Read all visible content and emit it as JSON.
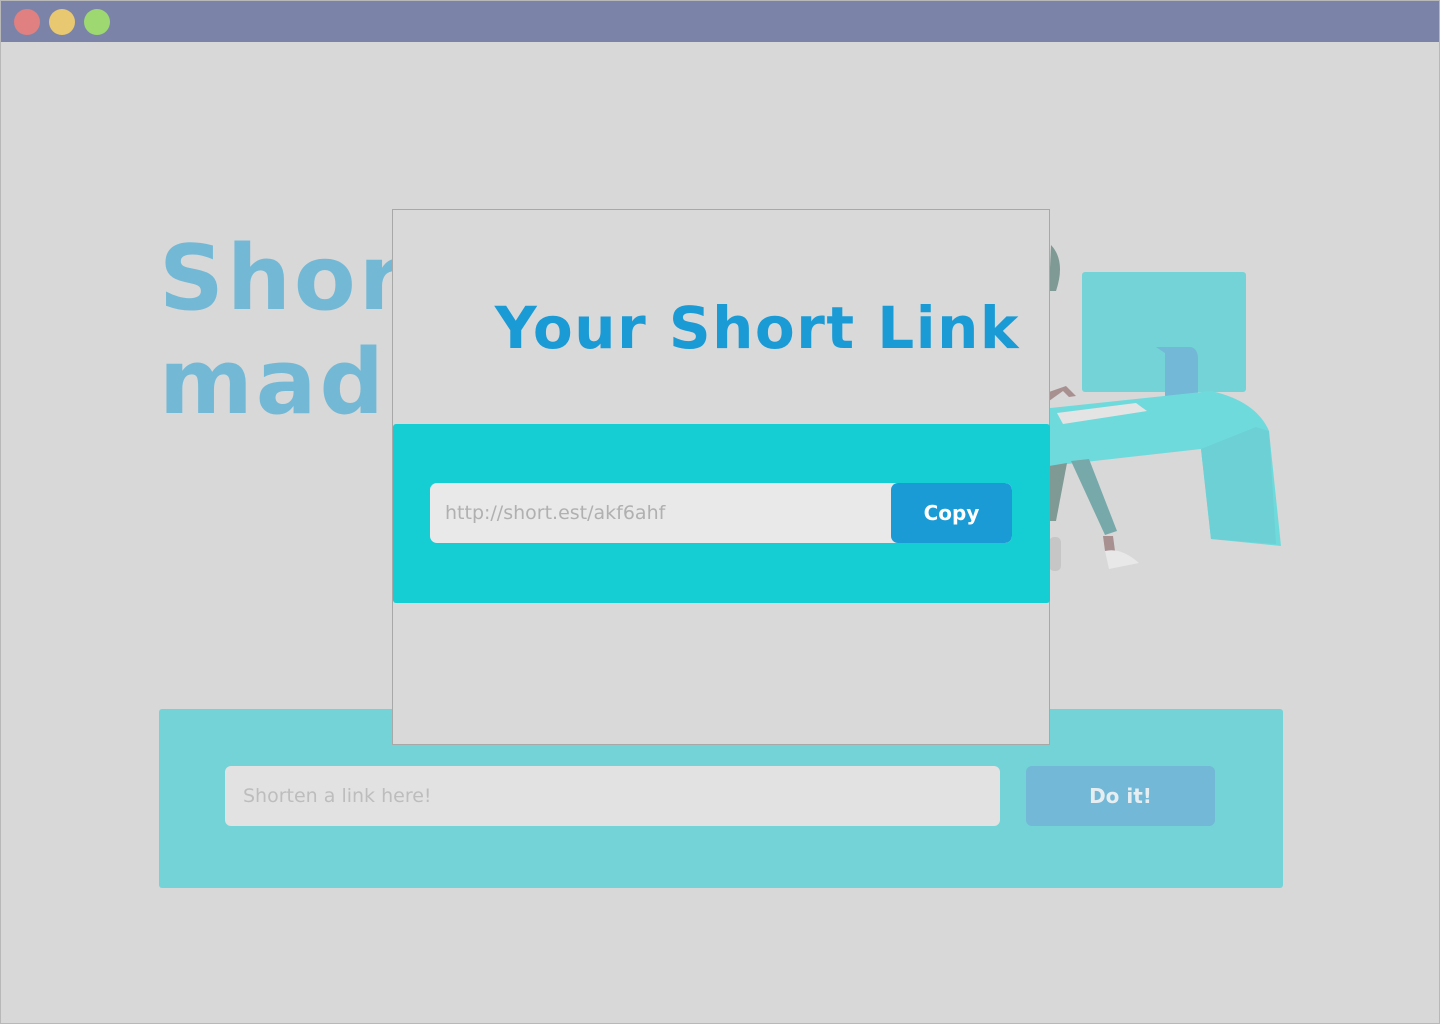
{
  "window": {
    "controls": [
      "close",
      "minimize",
      "maximize"
    ]
  },
  "hero": {
    "title": "Shor\nmad"
  },
  "shorten": {
    "placeholder": "Shorten a link here!",
    "button_label": "Do it!"
  },
  "modal": {
    "title": "Your Short Link",
    "short_link": "http://short.est/akf6ahf",
    "copy_label": "Copy"
  },
  "colors": {
    "titlebar": "#7b84a8",
    "accent_blue": "#1b9bd6",
    "accent_cyan": "#14ced4",
    "hero_text": "#73b9d6"
  }
}
